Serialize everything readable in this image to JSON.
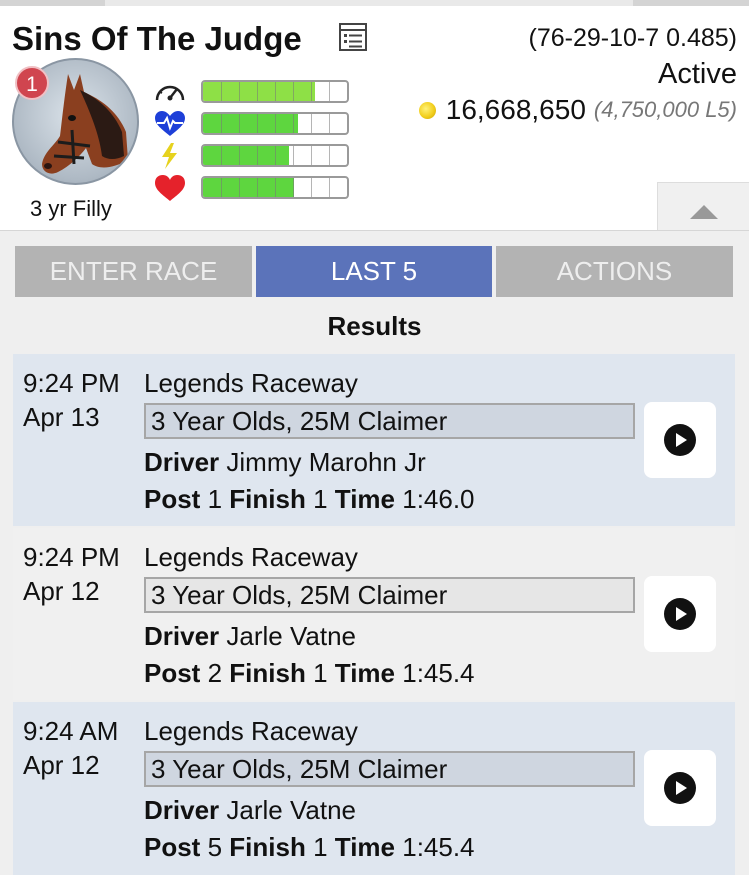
{
  "horse": {
    "name": "Sins Of The Judge",
    "record": "(76-29-10-7 0.485)",
    "status": "Active",
    "earnings": "16,668,650",
    "earnings_l5": "(4,750,000 L5)",
    "badge_number": "1",
    "age_sex": "3 yr Filly"
  },
  "stats": [
    {
      "icon": "speedometer-icon",
      "level": 0.78
    },
    {
      "icon": "heartbeat-icon",
      "level": 0.66
    },
    {
      "icon": "lightning-icon",
      "level": 0.6
    },
    {
      "icon": "heart-icon",
      "level": 0.63
    }
  ],
  "tabs": [
    {
      "label": "ENTER RACE",
      "active": false
    },
    {
      "label": "LAST 5",
      "active": true
    },
    {
      "label": "ACTIONS",
      "active": false
    }
  ],
  "results": {
    "title": "Results",
    "labels": {
      "driver": "Driver",
      "post": "Post",
      "finish": "Finish",
      "time": "Time"
    },
    "rows": [
      {
        "time": "9:24 PM",
        "date": "Apr 13",
        "track": "Legends Raceway",
        "condition": "3 Year Olds, 25M Claimer",
        "driver": "Jimmy Marohn Jr",
        "post": "1",
        "finish": "1",
        "race_time": "1:46.0"
      },
      {
        "time": "9:24 PM",
        "date": "Apr 12",
        "track": "Legends Raceway",
        "condition": "3 Year Olds, 25M Claimer",
        "driver": "Jarle Vatne",
        "post": "2",
        "finish": "1",
        "race_time": "1:45.4"
      },
      {
        "time": "9:24 AM",
        "date": "Apr 12",
        "track": "Legends Raceway",
        "condition": "3 Year Olds, 25M Claimer",
        "driver": "Jarle Vatne",
        "post": "5",
        "finish": "1",
        "race_time": "1:45.4"
      }
    ]
  },
  "colors": {
    "tab_active": "#5b73ba",
    "tab_inactive": "#b3b3b3",
    "bar_fill": "#5ed63f",
    "badge": "#d0454f"
  }
}
